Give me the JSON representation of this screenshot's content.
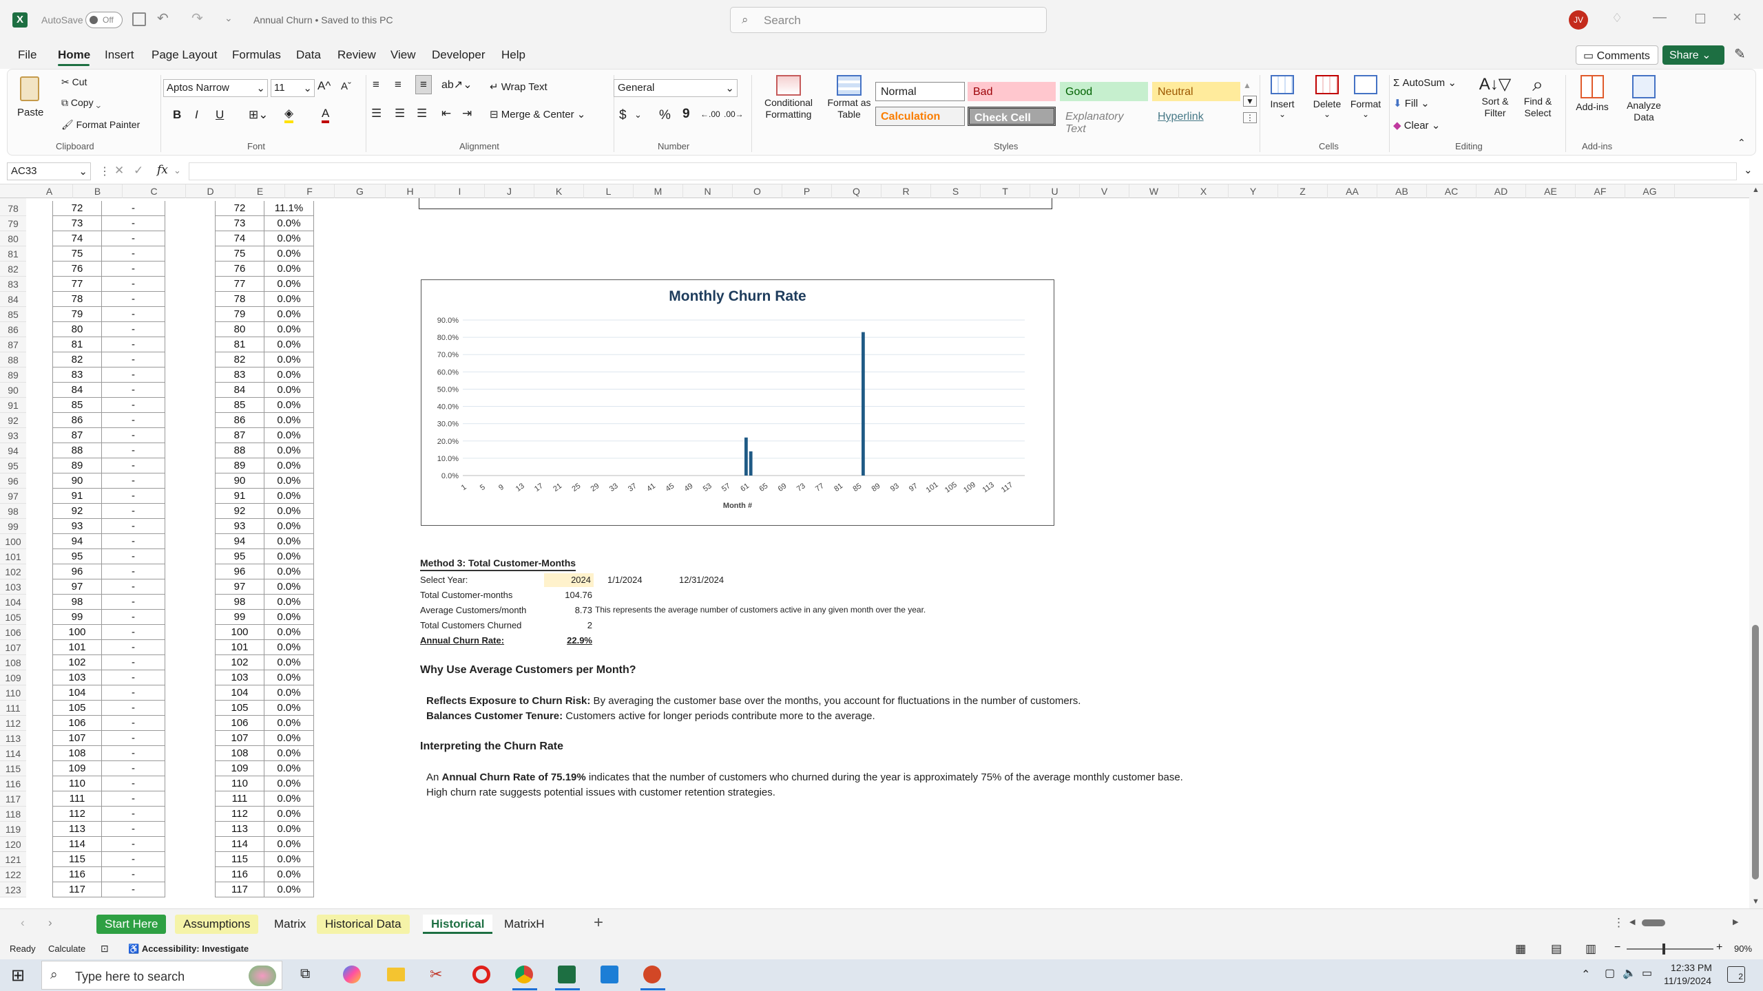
{
  "title_bar": {
    "app_badge": "X",
    "autosave_label": "AutoSave",
    "autosave_state": "Off",
    "doc_title": "Annual Churn • Saved to this PC",
    "search_placeholder": "Search",
    "user_initials": "JV"
  },
  "menu": {
    "items": [
      "File",
      "Home",
      "Insert",
      "Page Layout",
      "Formulas",
      "Data",
      "Review",
      "View",
      "Developer",
      "Help"
    ],
    "active": "Home",
    "comments": "Comments",
    "share": "Share"
  },
  "ribbon": {
    "clipboard": {
      "paste": "Paste",
      "cut": "Cut",
      "copy": "Copy",
      "format_painter": "Format Painter",
      "label": "Clipboard"
    },
    "font": {
      "name": "Aptos Narrow",
      "size": "11",
      "label": "Font",
      "bold": "B",
      "italic": "I",
      "underline": "U"
    },
    "alignment": {
      "wrap": "Wrap Text",
      "merge": "Merge & Center",
      "label": "Alignment"
    },
    "number": {
      "format": "General",
      "currency": "$",
      "percent": "%",
      "comma": "9",
      "label": "Number"
    },
    "styles": {
      "conditional": "Conditional Formatting",
      "format_as_table": "Format as Table",
      "normal": "Normal",
      "bad": "Bad",
      "good": "Good",
      "neutral": "Neutral",
      "calculation": "Calculation",
      "check_cell": "Check Cell",
      "explanatory": "Explanatory Text",
      "hyperlink": "Hyperlink",
      "label": "Styles"
    },
    "cells": {
      "insert": "Insert",
      "delete": "Delete",
      "format": "Format",
      "label": "Cells"
    },
    "editing": {
      "autosum": "AutoSum",
      "fill": "Fill",
      "clear": "Clear",
      "sort": "Sort & Filter",
      "find": "Find & Select",
      "label": "Editing"
    },
    "addins": {
      "addins": "Add-ins",
      "analyze": "Analyze Data",
      "label": "Add-ins"
    }
  },
  "formula_bar": {
    "name_box": "AC33",
    "fx": "fx",
    "value": ""
  },
  "columns": [
    "A",
    "B",
    "C",
    "D",
    "E",
    "F",
    "G",
    "H",
    "I",
    "J",
    "K",
    "L",
    "M",
    "N",
    "O",
    "P",
    "Q",
    "R",
    "S",
    "T",
    "U",
    "V",
    "W",
    "X",
    "Y",
    "Z",
    "AA",
    "AB",
    "AC",
    "AD",
    "AE",
    "AF",
    "AG"
  ],
  "rows": [
    {
      "n": "78",
      "b": "72",
      "c": "-",
      "e": "72",
      "f": "11.1%"
    },
    {
      "n": "79",
      "b": "73",
      "c": "-",
      "e": "73",
      "f": "0.0%"
    },
    {
      "n": "80",
      "b": "74",
      "c": "-",
      "e": "74",
      "f": "0.0%"
    },
    {
      "n": "81",
      "b": "75",
      "c": "-",
      "e": "75",
      "f": "0.0%"
    },
    {
      "n": "82",
      "b": "76",
      "c": "-",
      "e": "76",
      "f": "0.0%"
    },
    {
      "n": "83",
      "b": "77",
      "c": "-",
      "e": "77",
      "f": "0.0%"
    },
    {
      "n": "84",
      "b": "78",
      "c": "-",
      "e": "78",
      "f": "0.0%"
    },
    {
      "n": "85",
      "b": "79",
      "c": "-",
      "e": "79",
      "f": "0.0%"
    },
    {
      "n": "86",
      "b": "80",
      "c": "-",
      "e": "80",
      "f": "0.0%"
    },
    {
      "n": "87",
      "b": "81",
      "c": "-",
      "e": "81",
      "f": "0.0%"
    },
    {
      "n": "88",
      "b": "82",
      "c": "-",
      "e": "82",
      "f": "0.0%"
    },
    {
      "n": "89",
      "b": "83",
      "c": "-",
      "e": "83",
      "f": "0.0%"
    },
    {
      "n": "90",
      "b": "84",
      "c": "-",
      "e": "84",
      "f": "0.0%"
    },
    {
      "n": "91",
      "b": "85",
      "c": "-",
      "e": "85",
      "f": "0.0%"
    },
    {
      "n": "92",
      "b": "86",
      "c": "-",
      "e": "86",
      "f": "0.0%"
    },
    {
      "n": "93",
      "b": "87",
      "c": "-",
      "e": "87",
      "f": "0.0%"
    },
    {
      "n": "94",
      "b": "88",
      "c": "-",
      "e": "88",
      "f": "0.0%"
    },
    {
      "n": "95",
      "b": "89",
      "c": "-",
      "e": "89",
      "f": "0.0%"
    },
    {
      "n": "96",
      "b": "90",
      "c": "-",
      "e": "90",
      "f": "0.0%"
    },
    {
      "n": "97",
      "b": "91",
      "c": "-",
      "e": "91",
      "f": "0.0%"
    },
    {
      "n": "98",
      "b": "92",
      "c": "-",
      "e": "92",
      "f": "0.0%"
    },
    {
      "n": "99",
      "b": "93",
      "c": "-",
      "e": "93",
      "f": "0.0%"
    },
    {
      "n": "100",
      "b": "94",
      "c": "-",
      "e": "94",
      "f": "0.0%"
    },
    {
      "n": "101",
      "b": "95",
      "c": "-",
      "e": "95",
      "f": "0.0%"
    },
    {
      "n": "102",
      "b": "96",
      "c": "-",
      "e": "96",
      "f": "0.0%"
    },
    {
      "n": "103",
      "b": "97",
      "c": "-",
      "e": "97",
      "f": "0.0%"
    },
    {
      "n": "104",
      "b": "98",
      "c": "-",
      "e": "98",
      "f": "0.0%"
    },
    {
      "n": "105",
      "b": "99",
      "c": "-",
      "e": "99",
      "f": "0.0%"
    },
    {
      "n": "106",
      "b": "100",
      "c": "-",
      "e": "100",
      "f": "0.0%"
    },
    {
      "n": "107",
      "b": "101",
      "c": "-",
      "e": "101",
      "f": "0.0%"
    },
    {
      "n": "108",
      "b": "102",
      "c": "-",
      "e": "102",
      "f": "0.0%"
    },
    {
      "n": "109",
      "b": "103",
      "c": "-",
      "e": "103",
      "f": "0.0%"
    },
    {
      "n": "110",
      "b": "104",
      "c": "-",
      "e": "104",
      "f": "0.0%"
    },
    {
      "n": "111",
      "b": "105",
      "c": "-",
      "e": "105",
      "f": "0.0%"
    },
    {
      "n": "112",
      "b": "106",
      "c": "-",
      "e": "106",
      "f": "0.0%"
    },
    {
      "n": "113",
      "b": "107",
      "c": "-",
      "e": "107",
      "f": "0.0%"
    },
    {
      "n": "114",
      "b": "108",
      "c": "-",
      "e": "108",
      "f": "0.0%"
    },
    {
      "n": "115",
      "b": "109",
      "c": "-",
      "e": "109",
      "f": "0.0%"
    },
    {
      "n": "116",
      "b": "110",
      "c": "-",
      "e": "110",
      "f": "0.0%"
    },
    {
      "n": "117",
      "b": "111",
      "c": "-",
      "e": "111",
      "f": "0.0%"
    },
    {
      "n": "118",
      "b": "112",
      "c": "-",
      "e": "112",
      "f": "0.0%"
    },
    {
      "n": "119",
      "b": "113",
      "c": "-",
      "e": "113",
      "f": "0.0%"
    },
    {
      "n": "120",
      "b": "114",
      "c": "-",
      "e": "114",
      "f": "0.0%"
    },
    {
      "n": "121",
      "b": "115",
      "c": "-",
      "e": "115",
      "f": "0.0%"
    },
    {
      "n": "122",
      "b": "116",
      "c": "-",
      "e": "116",
      "f": "0.0%"
    },
    {
      "n": "123",
      "b": "117",
      "c": "-",
      "e": "117",
      "f": "0.0%"
    }
  ],
  "chart_data": {
    "type": "bar",
    "title": "Monthly Churn Rate",
    "xlabel": "Month #",
    "ylabel": "",
    "ylim": [
      0,
      0.9
    ],
    "y_ticks": [
      "0.0%",
      "10.0%",
      "20.0%",
      "30.0%",
      "40.0%",
      "50.0%",
      "60.0%",
      "70.0%",
      "80.0%",
      "90.0%"
    ],
    "x_tick_labels": [
      "1",
      "5",
      "9",
      "13",
      "17",
      "21",
      "25",
      "29",
      "33",
      "37",
      "41",
      "45",
      "49",
      "53",
      "57",
      "61",
      "65",
      "69",
      "73",
      "77",
      "81",
      "85",
      "89",
      "93",
      "97",
      "101",
      "105",
      "109",
      "113",
      "117"
    ],
    "x_range": [
      1,
      120
    ],
    "bars": [
      {
        "month": 61,
        "value": 0.22
      },
      {
        "month": 62,
        "value": 0.14
      },
      {
        "month": 86,
        "value": 0.83
      }
    ],
    "grid": true,
    "color": "#1f5a85"
  },
  "method3": {
    "heading": "Method 3: Total Customer-Months",
    "select_year_label": "Select Year:",
    "select_year_value": "2024",
    "start_date": "1/1/2024",
    "end_date": "12/31/2024",
    "tcm_label": "Total Customer-months",
    "tcm_value": "104.76",
    "avg_label": "Average Customers/month",
    "avg_value": "8.73",
    "avg_note": "This represents the average number of customers active in any given month over the year.",
    "churned_label": "Total Customers Churned",
    "churned_value": "2",
    "rate_label": "Annual Churn Rate:",
    "rate_value": "22.9%"
  },
  "explain": {
    "why_heading": "Why Use Average Customers per Month?",
    "point1_bold": "Reflects Exposure to Churn Risk:",
    "point1_text": " By averaging the customer base over the months, you account for fluctuations in the number of customers.",
    "point2_bold": "Balances Customer Tenure:",
    "point2_text": " Customers active for longer periods contribute more to the average.",
    "interp_heading": "Interpreting the Churn Rate",
    "interp1_pre": "An ",
    "interp1_bold": "Annual Churn Rate of 75.19%",
    "interp1_post": " indicates that the number of customers who churned during the year is approximately 75% of the average monthly customer base.",
    "interp2": "High churn rate suggests potential issues with customer retention strategies."
  },
  "sheet_tabs": [
    {
      "label": "Start Here",
      "bg": "#2ea043",
      "fg": "#ffffff"
    },
    {
      "label": "Assumptions",
      "bg": "#f5f3a8",
      "fg": "#222222"
    },
    {
      "label": "Matrix",
      "bg": "transparent",
      "fg": "#222222"
    },
    {
      "label": "Historical Data",
      "bg": "#f5f3a8",
      "fg": "#222222"
    },
    {
      "label": "Historical",
      "bg": "#ffffff",
      "fg": "#1d6f42"
    },
    {
      "label": "MatrixH",
      "bg": "transparent",
      "fg": "#222222"
    }
  ],
  "status": {
    "ready": "Ready",
    "calculate": "Calculate",
    "accessibility": "Accessibility: Investigate",
    "zoom": "90%"
  },
  "taskbar": {
    "search_placeholder": "Type here to search",
    "time": "12:33 PM",
    "date": "11/19/2024",
    "notif": "2"
  }
}
